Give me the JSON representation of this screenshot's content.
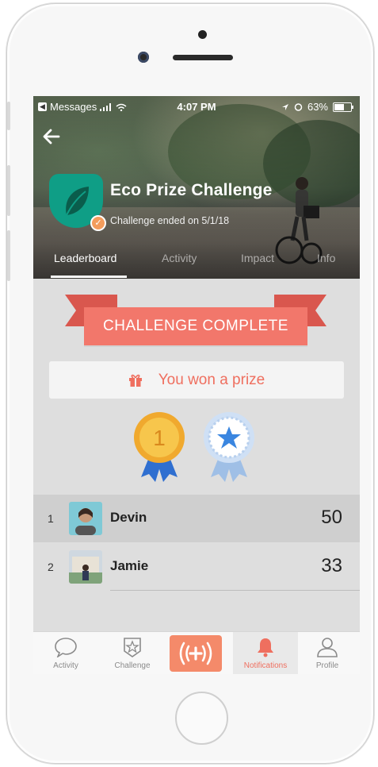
{
  "status_bar": {
    "carrier": "Messages",
    "time": "4:07 PM",
    "battery": "63%"
  },
  "header": {
    "title": "Eco Prize Challenge",
    "subtitle": "Challenge ended on 5/1/18",
    "badge_icon": "leaf-icon"
  },
  "tabs": [
    {
      "label": "Leaderboard",
      "active": true
    },
    {
      "label": "Activity",
      "active": false
    },
    {
      "label": "Impact",
      "active": false
    },
    {
      "label": "Info",
      "active": false
    }
  ],
  "banner": {
    "text": "CHALLENGE COMPLETE"
  },
  "prize": {
    "text": "You won a prize",
    "icon": "gift-icon"
  },
  "medals": [
    {
      "name": "gold-medal-icon",
      "label": "1"
    },
    {
      "name": "star-medal-icon"
    }
  ],
  "leaderboard": [
    {
      "rank": "1",
      "name": "Devin",
      "score": "50"
    },
    {
      "rank": "2",
      "name": "Jamie",
      "score": "33"
    }
  ],
  "bottom_nav": {
    "items": [
      {
        "label": "Activity",
        "icon": "chat-bubble-icon"
      },
      {
        "label": "Challenge",
        "icon": "star-badge-icon"
      },
      {
        "label": "",
        "icon": "broadcast-plus-icon"
      },
      {
        "label": "Notifications",
        "icon": "bell-icon",
        "active": true
      },
      {
        "label": "Profile",
        "icon": "person-icon"
      }
    ]
  },
  "colors": {
    "accent": "#f2776b",
    "badge": "#0f9e86",
    "gold": "#f5b63a",
    "ribbon_blue": "#2f6fd0"
  }
}
